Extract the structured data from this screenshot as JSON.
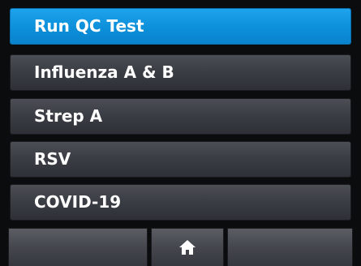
{
  "menu": {
    "items": [
      {
        "label": "Run QC Test",
        "selected": true
      },
      {
        "label": "Influenza A & B",
        "selected": false
      },
      {
        "label": "Strep A",
        "selected": false
      },
      {
        "label": "RSV",
        "selected": false
      },
      {
        "label": "COVID-19",
        "selected": false
      }
    ]
  },
  "bottom_bar": {
    "buttons": [
      {
        "icon": "",
        "label": ""
      },
      {
        "icon": "home-icon",
        "label": ""
      },
      {
        "icon": "",
        "label": ""
      }
    ]
  },
  "colors": {
    "selected_accent": "#0d8fda",
    "item_background": "#3b3e44",
    "screen_background": "#0b0c0e",
    "text": "#ffffff"
  }
}
